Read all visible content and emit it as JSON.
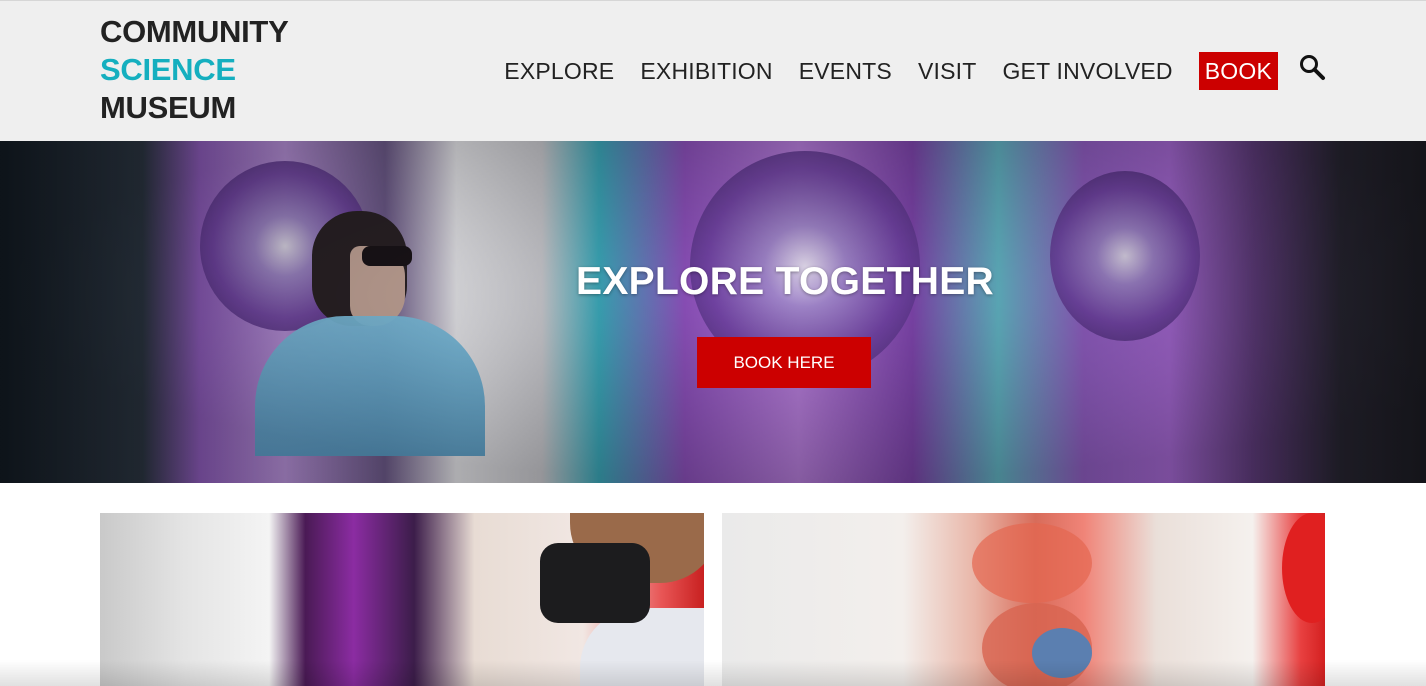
{
  "logo": {
    "line1": "COMMUNITY",
    "line2": "SCIENCE",
    "line3": "MUSEUM"
  },
  "nav": {
    "items": [
      "EXPLORE",
      "EXHIBITION",
      "EVENTS",
      "VISIT",
      "GET INVOLVED"
    ],
    "book_label": "BOOK",
    "search_icon": "search-icon"
  },
  "hero": {
    "title": "EXPLORE TOGETHER",
    "button_label": "BOOK HERE"
  },
  "colors": {
    "accent_red": "#cc0000",
    "accent_teal": "#15afbf",
    "header_bg": "#efefef"
  }
}
